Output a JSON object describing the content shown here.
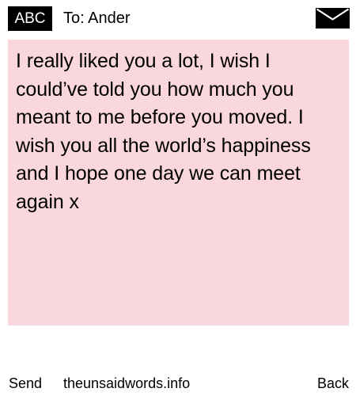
{
  "header": {
    "badge": "ABC",
    "recipient": "To: Ander",
    "envelope_icon": "envelope-icon"
  },
  "message": {
    "text": "I really liked you a lot, I wish I\ncould’ve told you how much you\nmeant to me before you moved. I\nwish you all the world’s happiness\nand I hope one day we can meet\nagain x",
    "background_color": "#f9d7dc"
  },
  "footer": {
    "send_label": "Send",
    "site_label": "theunsaidwords.info",
    "back_label": "Back"
  }
}
